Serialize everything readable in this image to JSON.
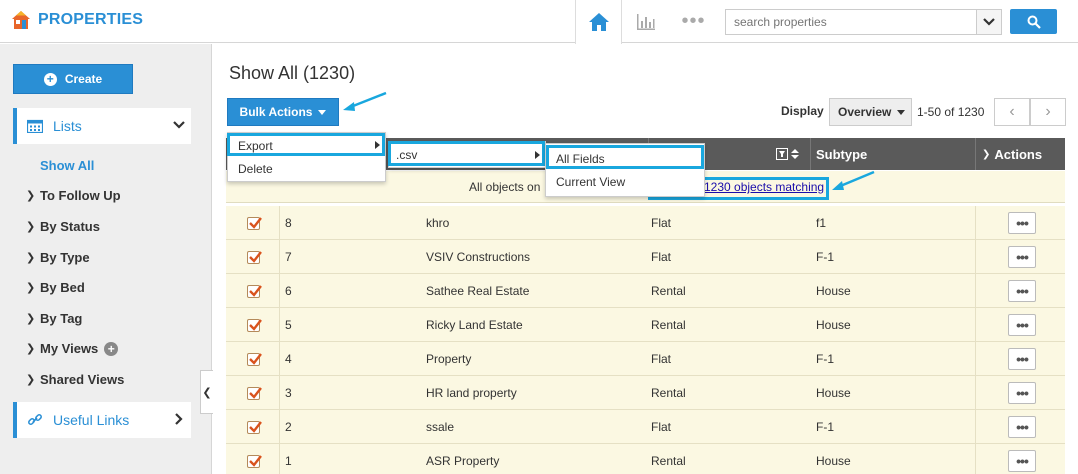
{
  "header": {
    "app_title": "PROPERTIES",
    "search_placeholder": "search properties",
    "icons": [
      "home-icon",
      "chart-icon",
      "more-icon",
      "search-icon"
    ]
  },
  "sidebar": {
    "create_label": "Create",
    "lists_label": "Lists",
    "active_item": "Show All",
    "items": [
      "To Follow Up",
      "By Status",
      "By Type",
      "By Bed",
      "By Tag",
      "My Views",
      "Shared Views"
    ],
    "useful_links_label": "Useful Links"
  },
  "main": {
    "title": "Show All (1230)",
    "bulk_actions_label": "Bulk Actions",
    "display_label": "Display",
    "display_value": "Overview",
    "paging_text": "1-50 of 1230",
    "menus": {
      "level1": [
        "Export",
        "Delete"
      ],
      "level2": [
        ".csv"
      ],
      "level3": [
        "All Fields",
        "Current View"
      ]
    },
    "table": {
      "headers": {
        "subtype": "Subtype",
        "actions": "Actions"
      },
      "notice_text": "All objects on",
      "notice_link": "1230 objects matching",
      "rows": [
        {
          "id": "8",
          "name": "khro",
          "type": "Flat",
          "subtype": "f1"
        },
        {
          "id": "7",
          "name": "VSIV Constructions",
          "type": "Flat",
          "subtype": "F-1"
        },
        {
          "id": "6",
          "name": "Sathee Real Estate",
          "type": "Rental",
          "subtype": "House"
        },
        {
          "id": "5",
          "name": "Ricky Land Estate",
          "type": "Rental",
          "subtype": "House"
        },
        {
          "id": "4",
          "name": "Property",
          "type": "Flat",
          "subtype": "F-1"
        },
        {
          "id": "3",
          "name": "HR land property",
          "type": "Rental",
          "subtype": "House"
        },
        {
          "id": "2",
          "name": "ssale",
          "type": "Flat",
          "subtype": "F-1"
        },
        {
          "id": "1",
          "name": "ASR Property",
          "type": "Rental",
          "subtype": "House"
        }
      ]
    }
  },
  "colors": {
    "accent": "#2a8fd5",
    "highlight": "#19a7de",
    "row_bg": "#fbf8e2",
    "header_bg": "#5a5a5a"
  }
}
